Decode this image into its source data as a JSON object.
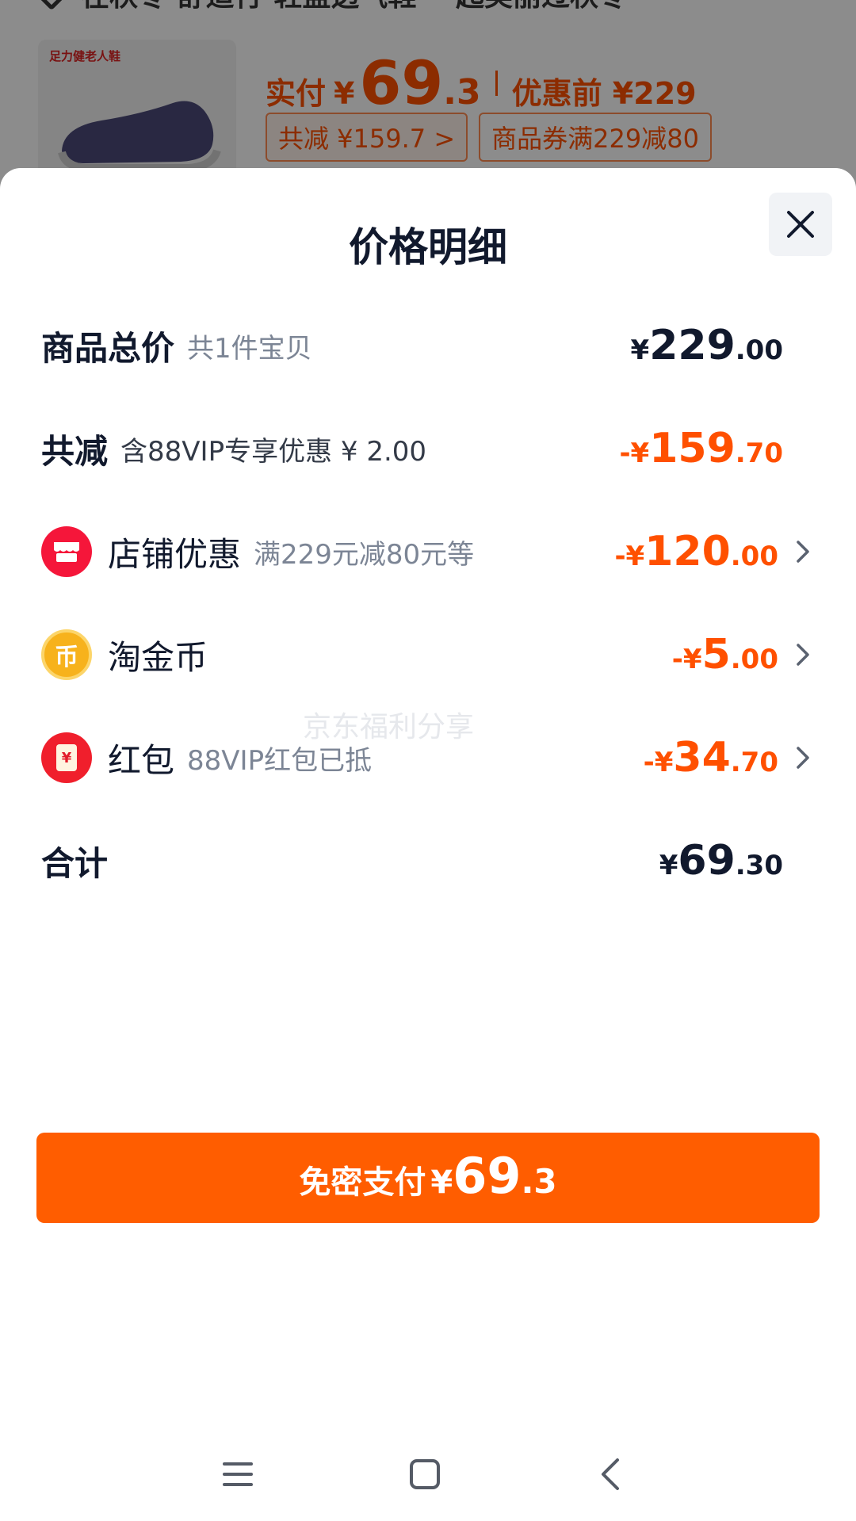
{
  "background": {
    "top_row_text": "在秋冬·舒适行·轻盈透气鞋·一起美丽过秋冬",
    "brand_text": "足力健老人鞋",
    "paid_label": "实付",
    "paid_yen": "¥",
    "paid_int": "69",
    "paid_dec": ".3",
    "before_label": "优惠前 ¥229",
    "tag_total_discount": "共减 ¥159.7 >",
    "tag_coupon": "商品券满229减80"
  },
  "sheet": {
    "title": "价格明细",
    "close_icon": "close-icon",
    "rows": {
      "total": {
        "label": "商品总价",
        "sub": "共1件宝贝",
        "yen": "¥",
        "int": "229",
        "dec": ".00"
      },
      "reduce": {
        "label": "共减",
        "sub": "含88VIP专享优惠 ¥ 2.00",
        "yen": "-¥",
        "int": "159",
        "dec": ".70"
      },
      "shop": {
        "label": "店铺优惠",
        "sub": "满229元减80元等",
        "yen": "-¥",
        "int": "120",
        "dec": ".00",
        "icon": "shop-icon"
      },
      "coin": {
        "label": "淘金币",
        "yen": "-¥",
        "int": "5",
        "dec": ".00",
        "icon": "coin-icon",
        "icon_glyph": "币"
      },
      "redpacket": {
        "label": "红包",
        "sub": "88VIP红包已抵",
        "yen": "-¥",
        "int": "34",
        "dec": ".70",
        "icon": "red-packet-icon",
        "icon_glyph": "¥"
      },
      "sum": {
        "label": "合计",
        "yen": "¥",
        "int": "69",
        "dec": ".30"
      }
    },
    "watermark": "京东福利分享"
  },
  "pay_button": {
    "label": "免密支付",
    "yen": "¥",
    "int": "69",
    "dec": ".3"
  },
  "nav": {
    "menu_icon": "menu-icon",
    "home_icon": "home-icon",
    "back_icon": "back-icon"
  },
  "colors": {
    "accent": "#ff5d00",
    "price_orange": "#ff5000",
    "text_dark": "#11192d",
    "text_gray": "#7c8595",
    "shop_red": "#f5163a",
    "coin_gold": "#f7b21c"
  }
}
